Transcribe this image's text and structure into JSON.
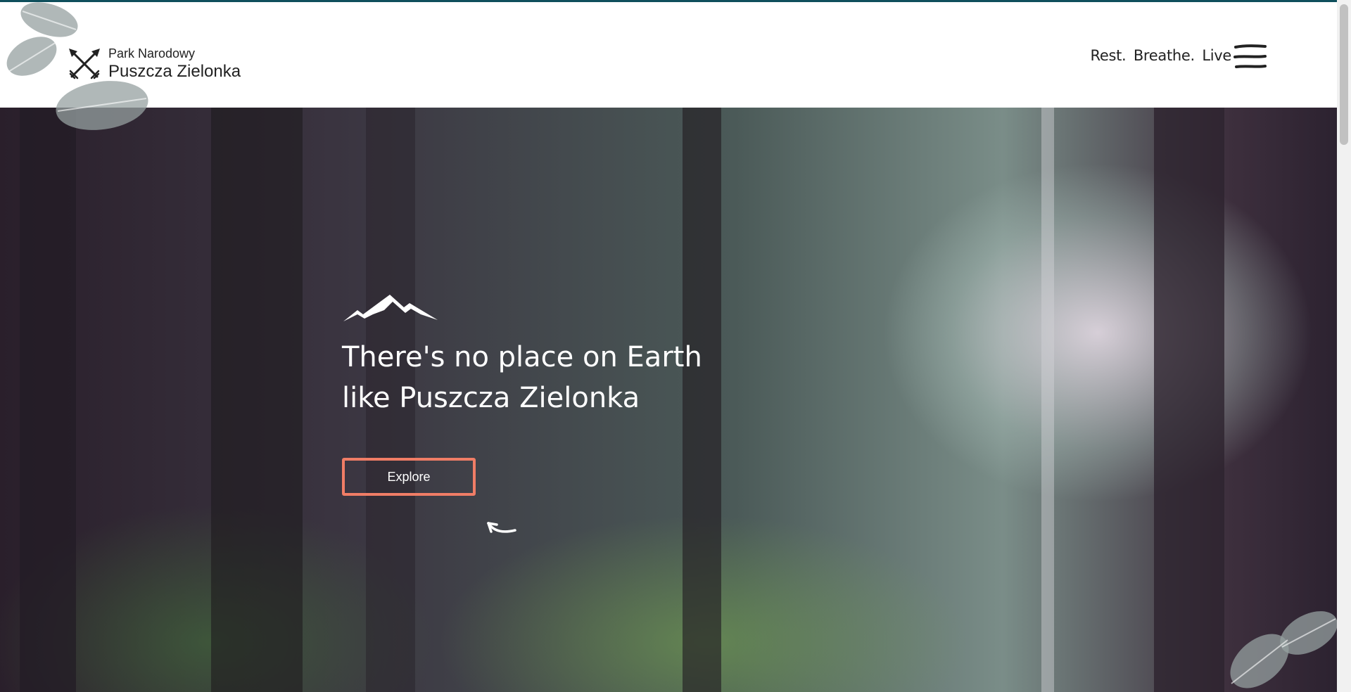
{
  "header": {
    "brand_small": "Park Narodowy",
    "brand_large": "Puszcza Zielonka",
    "tagline": [
      "Rest.",
      "Breathe.",
      "Live"
    ],
    "logo_icon": "crossed-arrows-icon",
    "menu_icon": "hamburger-menu-icon"
  },
  "hero": {
    "title_line1": "There's no place on Earth",
    "title_line2": "like Puszcza Zielonka",
    "button_label": "Explore",
    "button_border_color": "#f07d66",
    "mountain_icon": "mountain-icon",
    "arrow_icon": "hand-drawn-arrow-icon"
  },
  "colors": {
    "accent_line": "#0f4f5c",
    "header_bg": "#ffffff",
    "text_dark": "#222222",
    "text_light": "#ffffff"
  }
}
